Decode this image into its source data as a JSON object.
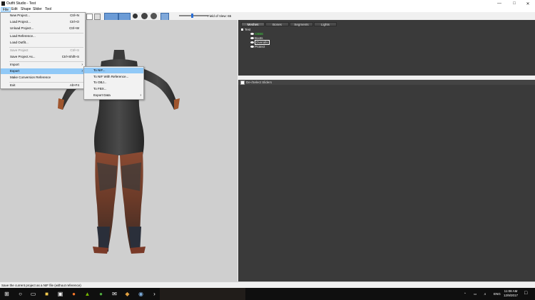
{
  "window": {
    "title": "Outfit Studio - Test",
    "controls": [
      "minimize",
      "maximize",
      "close"
    ]
  },
  "menubar": {
    "items": [
      "File",
      "Edit",
      "Shape",
      "Slider",
      "Tool"
    ],
    "active": "File"
  },
  "file_menu": {
    "items": [
      {
        "label": "New Project...",
        "shortcut": "Ctrl+N",
        "enabled": true
      },
      {
        "label": "Load Project...",
        "shortcut": "Ctrl+O",
        "enabled": true
      },
      {
        "label": "Unload Project...",
        "shortcut": "Ctrl+W",
        "enabled": true
      },
      {
        "label": "Load Reference...",
        "shortcut": "",
        "enabled": true
      },
      {
        "label": "Load Outfit...",
        "shortcut": "",
        "enabled": true
      },
      {
        "label": "Save Project",
        "shortcut": "Ctrl+S",
        "enabled": false
      },
      {
        "label": "Save Project As...",
        "shortcut": "Ctrl+Shift+S",
        "enabled": true
      },
      {
        "label": "Import",
        "shortcut": "",
        "submenu": true,
        "enabled": true
      },
      {
        "label": "Export",
        "shortcut": "",
        "submenu": true,
        "enabled": true,
        "highlighted": true
      },
      {
        "label": "Make Conversion Reference",
        "shortcut": "",
        "enabled": true
      },
      {
        "label": "Exit",
        "shortcut": "Alt+F4",
        "enabled": true
      }
    ]
  },
  "export_submenu": {
    "items": [
      {
        "label": "To NIF...",
        "highlighted": true
      },
      {
        "label": "To NIF With Reference..."
      },
      {
        "label": "To OBJ..."
      },
      {
        "label": "To FBX..."
      },
      {
        "label": "Export Data",
        "submenu": true
      }
    ]
  },
  "toolbar": {
    "field_of_view_label": "Field of View: 65",
    "field_of_view": 65
  },
  "right_panel": {
    "tabs": [
      "Meshes",
      "Bones",
      "Segments",
      "Lights"
    ],
    "active_tab": "Meshes",
    "tree": {
      "root": "Test",
      "children": [
        {
          "label": "CBBE",
          "color": "#3cd13c"
        },
        {
          "label": "Boots",
          "color": "#e8e8e8"
        },
        {
          "label": "Overalls",
          "color": "#ffffff",
          "selected": true
        },
        {
          "label": "Protect",
          "color": "#e8e8e8"
        }
      ]
    },
    "slider_header": "De-/Select Sliders"
  },
  "statusbar": {
    "text": "Save the current project as a NIF file (without reference)"
  },
  "taskbar": {
    "icons": [
      "windows-start-icon",
      "search-icon",
      "task-view-icon",
      "file-explorer-icon",
      "store-icon",
      "firefox-icon",
      "nvidia-icon",
      "xbox-icon",
      "mail-icon",
      "game-icon",
      "steam-icon",
      "terminal-icon"
    ],
    "language": "ENG",
    "time": "11:08 AM",
    "date": "12/9/2017"
  },
  "colors": {
    "viewport_bg": "#cfcfcf",
    "panel_bg": "#3a3a3a",
    "menu_highlight": "#91c9f7",
    "accent_green": "#3cd13c"
  }
}
